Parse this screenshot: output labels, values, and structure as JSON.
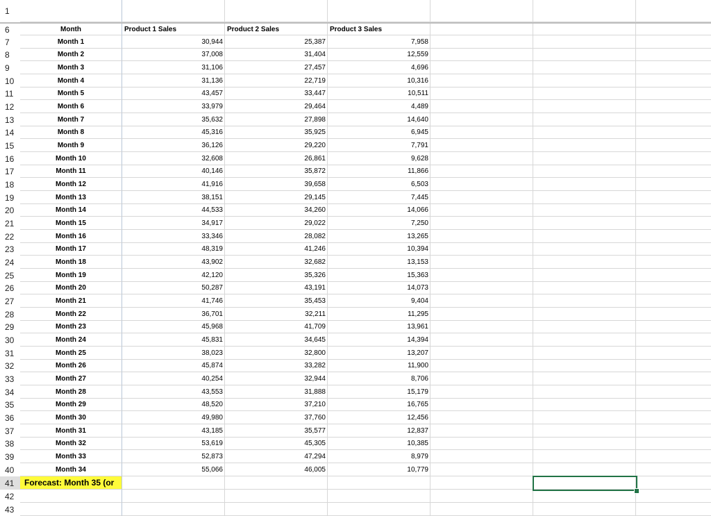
{
  "headers": {
    "row_number": "6",
    "month": "Month",
    "product1": "Product 1 Sales",
    "product2": "Product 2 Sales",
    "product3": "Product 3 Sales"
  },
  "top_row_number": "1",
  "rows": [
    {
      "n": "7",
      "month": "Month 1",
      "p1": "30,944",
      "p2": "25,387",
      "p3": "7,958"
    },
    {
      "n": "8",
      "month": "Month 2",
      "p1": "37,008",
      "p2": "31,404",
      "p3": "12,559"
    },
    {
      "n": "9",
      "month": "Month 3",
      "p1": "31,106",
      "p2": "27,457",
      "p3": "4,696"
    },
    {
      "n": "10",
      "month": "Month 4",
      "p1": "31,136",
      "p2": "22,719",
      "p3": "10,316"
    },
    {
      "n": "11",
      "month": "Month 5",
      "p1": "43,457",
      "p2": "33,447",
      "p3": "10,511"
    },
    {
      "n": "12",
      "month": "Month 6",
      "p1": "33,979",
      "p2": "29,464",
      "p3": "4,489"
    },
    {
      "n": "13",
      "month": "Month 7",
      "p1": "35,632",
      "p2": "27,898",
      "p3": "14,640"
    },
    {
      "n": "14",
      "month": "Month 8",
      "p1": "45,316",
      "p2": "35,925",
      "p3": "6,945"
    },
    {
      "n": "15",
      "month": "Month 9",
      "p1": "36,126",
      "p2": "29,220",
      "p3": "7,791"
    },
    {
      "n": "16",
      "month": "Month 10",
      "p1": "32,608",
      "p2": "26,861",
      "p3": "9,628"
    },
    {
      "n": "17",
      "month": "Month 11",
      "p1": "40,146",
      "p2": "35,872",
      "p3": "11,866"
    },
    {
      "n": "18",
      "month": "Month 12",
      "p1": "41,916",
      "p2": "39,658",
      "p3": "6,503"
    },
    {
      "n": "19",
      "month": "Month 13",
      "p1": "38,151",
      "p2": "29,145",
      "p3": "7,445"
    },
    {
      "n": "20",
      "month": "Month 14",
      "p1": "44,533",
      "p2": "34,260",
      "p3": "14,066"
    },
    {
      "n": "21",
      "month": "Month 15",
      "p1": "34,917",
      "p2": "29,022",
      "p3": "7,250"
    },
    {
      "n": "22",
      "month": "Month 16",
      "p1": "33,346",
      "p2": "28,082",
      "p3": "13,265"
    },
    {
      "n": "23",
      "month": "Month 17",
      "p1": "48,319",
      "p2": "41,246",
      "p3": "10,394"
    },
    {
      "n": "24",
      "month": "Month 18",
      "p1": "43,902",
      "p2": "32,682",
      "p3": "13,153"
    },
    {
      "n": "25",
      "month": "Month 19",
      "p1": "42,120",
      "p2": "35,326",
      "p3": "15,363"
    },
    {
      "n": "26",
      "month": "Month 20",
      "p1": "50,287",
      "p2": "43,191",
      "p3": "14,073"
    },
    {
      "n": "27",
      "month": "Month 21",
      "p1": "41,746",
      "p2": "35,453",
      "p3": "9,404"
    },
    {
      "n": "28",
      "month": "Month 22",
      "p1": "36,701",
      "p2": "32,211",
      "p3": "11,295"
    },
    {
      "n": "29",
      "month": "Month 23",
      "p1": "45,968",
      "p2": "41,709",
      "p3": "13,961"
    },
    {
      "n": "30",
      "month": "Month 24",
      "p1": "45,831",
      "p2": "34,645",
      "p3": "14,394"
    },
    {
      "n": "31",
      "month": "Month 25",
      "p1": "38,023",
      "p2": "32,800",
      "p3": "13,207"
    },
    {
      "n": "32",
      "month": "Month 26",
      "p1": "45,874",
      "p2": "33,282",
      "p3": "11,900"
    },
    {
      "n": "33",
      "month": "Month 27",
      "p1": "40,254",
      "p2": "32,944",
      "p3": "8,706"
    },
    {
      "n": "34",
      "month": "Month 28",
      "p1": "43,553",
      "p2": "31,888",
      "p3": "15,179"
    },
    {
      "n": "35",
      "month": "Month 29",
      "p1": "48,520",
      "p2": "37,210",
      "p3": "16,765"
    },
    {
      "n": "36",
      "month": "Month 30",
      "p1": "49,980",
      "p2": "37,760",
      "p3": "12,456"
    },
    {
      "n": "37",
      "month": "Month 31",
      "p1": "43,185",
      "p2": "35,577",
      "p3": "12,837"
    },
    {
      "n": "38",
      "month": "Month 32",
      "p1": "53,619",
      "p2": "45,305",
      "p3": "10,385"
    },
    {
      "n": "39",
      "month": "Month 33",
      "p1": "52,873",
      "p2": "47,294",
      "p3": "8,979"
    },
    {
      "n": "40",
      "month": "Month 34",
      "p1": "55,066",
      "p2": "46,005",
      "p3": "10,779"
    }
  ],
  "forecast_row": {
    "n": "41",
    "label": "Forecast: Month 35 (or"
  },
  "extra_rows": [
    "42",
    "43"
  ],
  "colors": {
    "forecast_bg": "#fffb3a",
    "selection": "#217346",
    "selected_header": "#dfdfdf"
  }
}
